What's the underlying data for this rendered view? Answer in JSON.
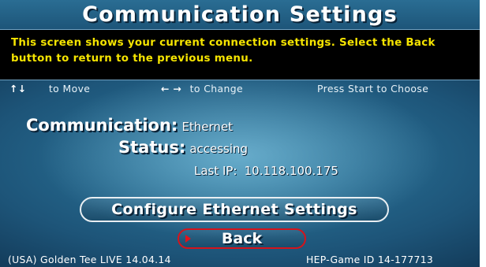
{
  "screen": {
    "title": "Communication Settings",
    "info_text": "This screen shows your current connection settings.  Select the Back button to return to the previous menu."
  },
  "hints": {
    "move_icon": "up-down-arrows-icon",
    "move_label": "to Move",
    "change_icon": "left-right-arrows-icon",
    "change_label": "to Change",
    "choose_label": "Press Start to Choose"
  },
  "settings": {
    "communication_label": "Communication:",
    "communication_value": "Ethernet",
    "status_label": "Status:",
    "status_value": "accessing",
    "last_ip_label": "Last IP:",
    "last_ip_value": "10.118.100.175"
  },
  "buttons": {
    "configure_label": "Configure Ethernet Settings",
    "back_label": "Back"
  },
  "footer": {
    "version": "(USA) Golden Tee LIVE 14.04.14",
    "game_id": "HEP-Game ID 14-177713"
  },
  "colors": {
    "info_text": "#f5e400",
    "back_border": "#d4141c",
    "background": "#1d5478"
  }
}
